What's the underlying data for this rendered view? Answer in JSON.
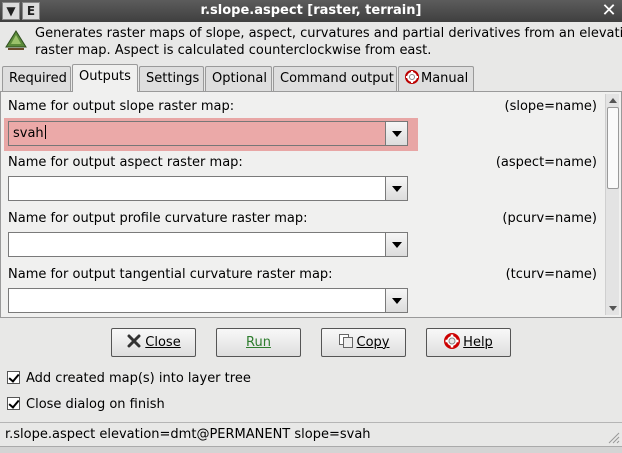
{
  "window": {
    "title": "r.slope.aspect [raster, terrain]",
    "menu_button": "▼",
    "e_button": "E",
    "close_glyph": "✕"
  },
  "description": {
    "line1": "Generates raster maps of slope, aspect, curvatures and partial derivatives from an elevatio",
    "line2": "raster map. Aspect is calculated counterclockwise from east."
  },
  "tabs": [
    {
      "label": "Required",
      "active": false
    },
    {
      "label": "Outputs",
      "active": true
    },
    {
      "label": "Settings",
      "active": false
    },
    {
      "label": "Optional",
      "active": false
    },
    {
      "label": "Command output",
      "active": false
    },
    {
      "label": "Manual",
      "active": false,
      "icon": "lifebuoy-icon"
    }
  ],
  "fields": [
    {
      "label": "Name for output slope raster map:",
      "key": "(slope=name)",
      "value": "svah",
      "highlighted": true
    },
    {
      "label": "Name for output aspect raster map:",
      "key": "(aspect=name)",
      "value": ""
    },
    {
      "label": "Name for output profile curvature raster map:",
      "key": "(pcurv=name)",
      "value": ""
    },
    {
      "label": "Name for output tangential curvature raster map:",
      "key": "(tcurv=name)",
      "value": ""
    }
  ],
  "buttons": {
    "close": {
      "label": "Close",
      "icon": "close-x-icon"
    },
    "run": {
      "label": "Run"
    },
    "copy": {
      "label": "Copy",
      "icon": "copy-icon"
    },
    "help": {
      "label": "Help",
      "icon": "lifebuoy-icon"
    }
  },
  "options": {
    "add_to_tree": {
      "label": "Add created map(s) into layer tree",
      "checked": true
    },
    "close_on_finish": {
      "label": "Close dialog on finish",
      "checked": true
    }
  },
  "statusbar": {
    "command": "r.slope.aspect elevation=dmt@PERMANENT slope=svah"
  },
  "colors": {
    "highlight": "#e8a6a5",
    "titlebar": "#4a4a4a",
    "run_label": "#2e7d2e"
  }
}
